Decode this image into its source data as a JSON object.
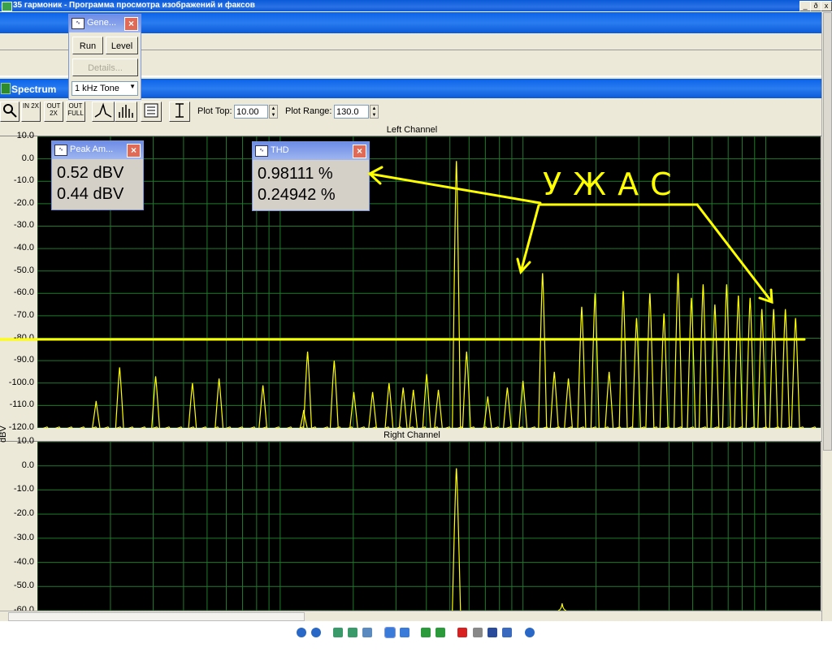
{
  "viewer": {
    "title": "35 гармоник - Программа просмотра изображений и факсов",
    "controls": [
      "_",
      "ð",
      "x"
    ]
  },
  "spectrum": {
    "title": "Spectrum",
    "plot_top_label": "Plot Top:",
    "plot_top_value": "10.00",
    "plot_range_label": "Plot Range:",
    "plot_range_value": "130.0",
    "y_unit": "dBV",
    "toolbar_buttons": [
      {
        "icon": "zoom-icon",
        "label": ""
      },
      {
        "icon": "in-2x-icon",
        "label": "IN 2X"
      },
      {
        "icon": "out-2x-icon",
        "label": "OUT 2X"
      },
      {
        "icon": "out-full-icon",
        "label": "OUT FULL"
      },
      {
        "icon": "line-mode-icon",
        "label": ""
      },
      {
        "icon": "bar-mode-icon",
        "label": ""
      },
      {
        "icon": "settings-icon",
        "label": ""
      },
      {
        "icon": "range-icon",
        "label": ""
      }
    ]
  },
  "generator": {
    "title": "Gene...",
    "run_label": "Run",
    "level_label": "Level",
    "details_label": "Details...",
    "tone_selected": "1 kHz Tone"
  },
  "peak": {
    "title": "Peak Am...",
    "left": "0.52 dBV",
    "right": "0.44 dBV"
  },
  "thd": {
    "title": "THD",
    "left": "0.98111 %",
    "right": "0.24942 %"
  },
  "annotation": {
    "text": "УЖАС",
    "color": "#ffff00"
  },
  "chart_data": [
    {
      "type": "line",
      "title": "Left Channel",
      "ylabel": "dBV",
      "ylim": [
        -120,
        10
      ],
      "yticks": [
        "10.0",
        "0.0",
        "-10.0",
        "-20.0",
        "-30.0",
        "-40.0",
        "-50.0",
        "-60.0",
        "-70.0",
        "-80.0",
        "-90.0",
        "-100.0",
        "-110.0",
        "-120.0"
      ],
      "grid": true,
      "line_color": "#ffff00",
      "series": [
        {
          "x_fraction": [
            0.075,
            0.105,
            0.151,
            0.198,
            0.232,
            0.288,
            0.34,
            0.345,
            0.379,
            0.404,
            0.428,
            0.449,
            0.467,
            0.48,
            0.497,
            0.512,
            0.535,
            0.548,
            0.575,
            0.6,
            0.62,
            0.645,
            0.66,
            0.678,
            0.695,
            0.712,
            0.73,
            0.748,
            0.765,
            0.782,
            0.8,
            0.818,
            0.835,
            0.85,
            0.865,
            0.88,
            0.895,
            0.91,
            0.925,
            0.94,
            0.955,
            0.968
          ],
          "values": [
            -108,
            -93,
            -97,
            -100,
            -98,
            -101,
            -112,
            -86,
            -90,
            -104,
            -104,
            -100,
            -102,
            -103,
            -96,
            -103,
            -1,
            -86,
            -106,
            -102,
            -99,
            -51,
            -95,
            -98,
            -66,
            -60,
            -95,
            -59,
            -71,
            -60,
            -69,
            -51,
            -62,
            -56,
            -65,
            -56,
            -61,
            -62,
            -67,
            -67,
            -67,
            -71
          ]
        }
      ],
      "noise_floor_dBV": -121,
      "threshold_line_dBV": -80.7
    },
    {
      "type": "line",
      "title": "Right Channel",
      "ylabel": "dBV",
      "ylim": [
        -60,
        10
      ],
      "yticks": [
        "10.0",
        "0.0",
        "-10.0",
        "-20.0",
        "-30.0",
        "-40.0",
        "-50.0",
        "-60.0"
      ],
      "grid": true,
      "line_color": "#ffff00",
      "series": [
        {
          "x_fraction": [
            0.535,
            0.67,
            0.71
          ],
          "values": [
            -1,
            -57,
            -61
          ]
        }
      ]
    }
  ]
}
